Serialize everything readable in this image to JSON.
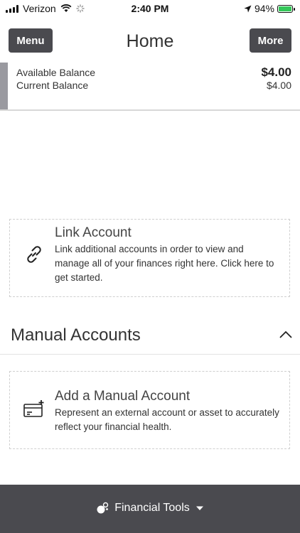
{
  "status_bar": {
    "carrier": "Verizon",
    "time": "2:40 PM",
    "battery_percent": "94%",
    "battery_color": "#34c759"
  },
  "nav": {
    "menu_label": "Menu",
    "title": "Home",
    "more_label": "More"
  },
  "balance": {
    "available_label": "Available Balance",
    "available_value": "$4.00",
    "current_label": "Current Balance",
    "current_value": "$4.00"
  },
  "link_account": {
    "icon": "link-icon",
    "title": "Link Account",
    "description": "Link additional accounts in order to view and manage all of your finances right here. Click here to get started."
  },
  "manual_accounts": {
    "section_title": "Manual Accounts",
    "expanded": true,
    "add_card": {
      "icon": "card-add-icon",
      "title": "Add a Manual Account",
      "description": "Represent an external account or asset to accurately reflect your financial health."
    }
  },
  "bottom_bar": {
    "icon": "financial-tools-icon",
    "label": "Financial Tools",
    "background": "#4a4a4f"
  }
}
